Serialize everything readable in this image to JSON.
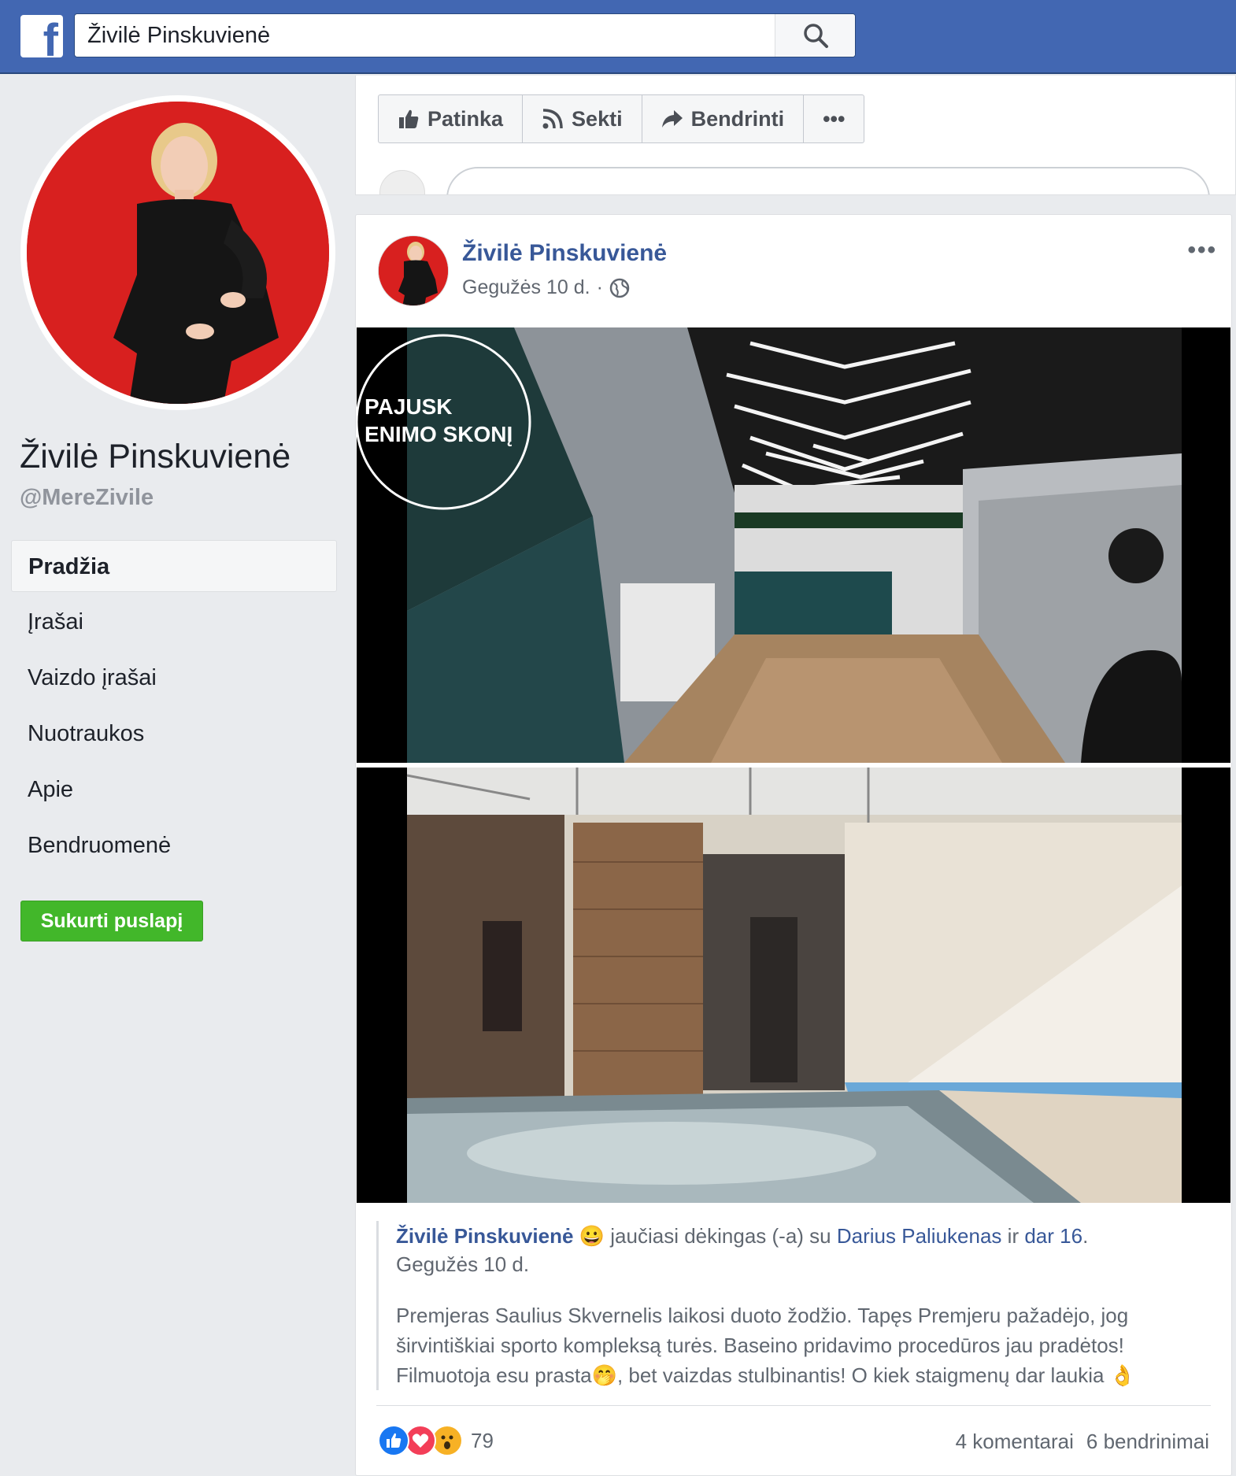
{
  "topbar": {
    "logo": "f",
    "search_value": "Živilė Pinskuvienė",
    "search_icon": "search-icon"
  },
  "sidebar": {
    "page_name": "Živilė Pinskuvienė",
    "handle": "@MereZivile",
    "nav": [
      {
        "label": "Pradžia",
        "active": true
      },
      {
        "label": "Įrašai"
      },
      {
        "label": "Vaizdo įrašai"
      },
      {
        "label": "Nuotraukos"
      },
      {
        "label": "Apie"
      },
      {
        "label": "Bendruomenė"
      }
    ],
    "create_button": "Sukurti puslapį"
  },
  "actions": {
    "like": "Patinka",
    "follow": "Sekti",
    "share": "Bendrinti",
    "more": "•••"
  },
  "post": {
    "author": "Živilė Pinskuvienė",
    "date": "Gegužės 10 d.",
    "separator": "·",
    "more": "•••",
    "shared": {
      "author": "Živilė Pinskuvienė",
      "emoji": "😀",
      "feeling": "jaučiasi dėkingas (-a) su",
      "tagged": "Darius Paliukenas",
      "and": "ir",
      "others": "dar 16",
      "period": ".",
      "date": "Gegužės 10 d.",
      "body_1": "Premjeras Saulius Skvernelis laikosi duoto žodžio. Tapęs Premjeru pažadėjo, jog širvintiškiai sporto kompleksą turės. Baseino pridavimo procedūros jau pradėtos! Filmuotoja esu prasta",
      "emoji_2": "🤭",
      "body_2": ", bet vaizdas stulbinantis! O kiek staigmenų dar laukia",
      "emoji_3": "👌"
    },
    "reactions_count": "79",
    "comments": "4 komentarai",
    "shares": "6 bendrinimai"
  },
  "colors": {
    "brand": "#4267b2",
    "link": "#385898",
    "green": "#42b72a",
    "avatar_bg": "#d8201f"
  }
}
